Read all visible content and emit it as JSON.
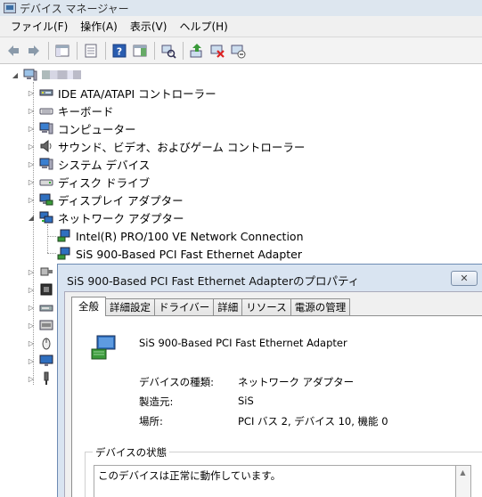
{
  "window": {
    "title": "デバイス マネージャー"
  },
  "menu": [
    "ファイル(F)",
    "操作(A)",
    "表示(V)",
    "ヘルプ(H)"
  ],
  "toolbar": {
    "buttons": [
      "back-icon",
      "forward-icon",
      "show-hide-tree-icon",
      "properties-icon",
      "help-icon",
      "action-pane-icon",
      "scan-hardware-icon",
      "update-driver-icon",
      "uninstall-icon",
      "disable-icon"
    ]
  },
  "tree": {
    "root": "",
    "items": [
      {
        "label": "IDE ATA/ATAPI コントローラー",
        "icon": "ide-controller-icon",
        "expanded": false
      },
      {
        "label": "キーボード",
        "icon": "keyboard-icon",
        "expanded": false
      },
      {
        "label": "コンピューター",
        "icon": "computer-icon",
        "expanded": false
      },
      {
        "label": "サウンド、ビデオ、およびゲーム コントローラー",
        "icon": "speaker-icon",
        "expanded": false
      },
      {
        "label": "システム デバイス",
        "icon": "system-device-icon",
        "expanded": false
      },
      {
        "label": "ディスク ドライブ",
        "icon": "disk-drive-icon",
        "expanded": false
      },
      {
        "label": "ディスプレイ アダプター",
        "icon": "display-adapter-icon",
        "expanded": false
      },
      {
        "label": "ネットワーク アダプター",
        "icon": "network-adapter-icon",
        "expanded": true,
        "children": [
          {
            "label": "Intel(R) PRO/100 VE Network Connection",
            "icon": "network-card-icon"
          },
          {
            "label": "SiS 900-Based PCI Fast Ethernet Adapter",
            "icon": "network-card-icon"
          }
        ]
      }
    ],
    "hidden_items": [
      "port-icon",
      "processor-icon",
      "storage-controller-icon",
      "usb-controller-icon",
      "mouse-icon",
      "monitor-icon",
      "usb-icon"
    ]
  },
  "dialog": {
    "title": "SiS 900-Based PCI Fast Ethernet Adapterのプロパティ",
    "close_label": "✕",
    "tabs": [
      "全般",
      "詳細設定",
      "ドライバー",
      "詳細",
      "リソース",
      "電源の管理"
    ],
    "active_tab": "全般",
    "device_name": "SiS 900-Based PCI Fast Ethernet Adapter",
    "properties": [
      {
        "label": "デバイスの種類:",
        "value": "ネットワーク アダプター"
      },
      {
        "label": "製造元:",
        "value": "SiS"
      },
      {
        "label": "場所:",
        "value": "PCI バス 2, デバイス 10, 機能 0"
      }
    ],
    "status_legend": "デバイスの状態",
    "status_text": "このデバイスは正常に動作しています。"
  },
  "colors": {
    "dialog_frame": "#d9e4f1",
    "dialog_border": "#6d8bb3",
    "titlebar": "#dde6ef",
    "menubar": "#f0f0f0"
  }
}
